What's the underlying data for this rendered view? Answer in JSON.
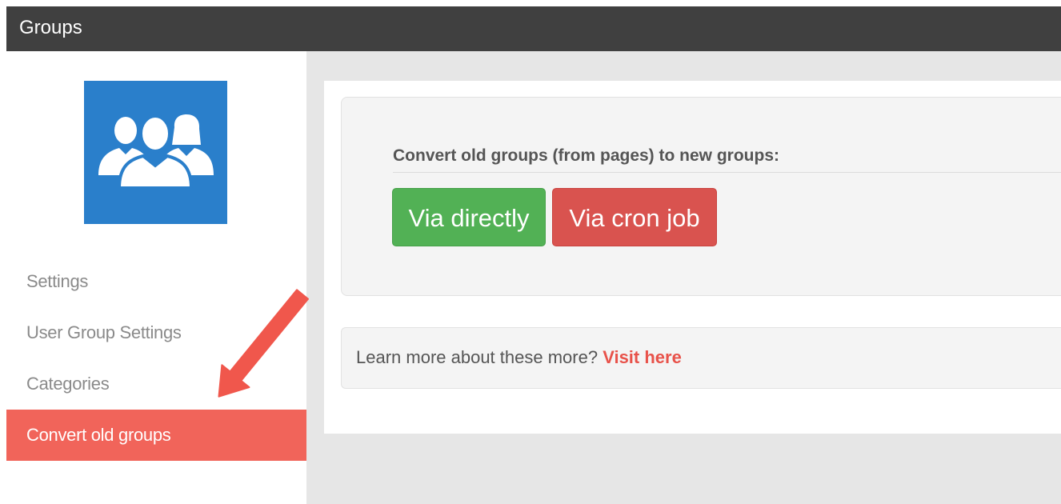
{
  "header": {
    "title": "Groups"
  },
  "sidebar": {
    "logo_icon": "users-group-icon",
    "logo_color": "#2a7fcb",
    "items": [
      {
        "label": "Settings",
        "active": false
      },
      {
        "label": "User Group Settings",
        "active": false
      },
      {
        "label": "Categories",
        "active": false
      },
      {
        "label": "Convert old groups",
        "active": true
      }
    ],
    "active_color": "#f1645a"
  },
  "main": {
    "convert": {
      "title": "Convert old groups (from pages) to new groups:",
      "buttons": [
        {
          "label": "Via directly",
          "color": "#52b155"
        },
        {
          "label": "Via cron job",
          "color": "#d9534f"
        }
      ]
    },
    "learn": {
      "text": "Learn more about these more? ",
      "link_label": "Visit here"
    }
  },
  "annotation": {
    "icon": "pointer-arrow-icon",
    "color": "#f0574c"
  }
}
